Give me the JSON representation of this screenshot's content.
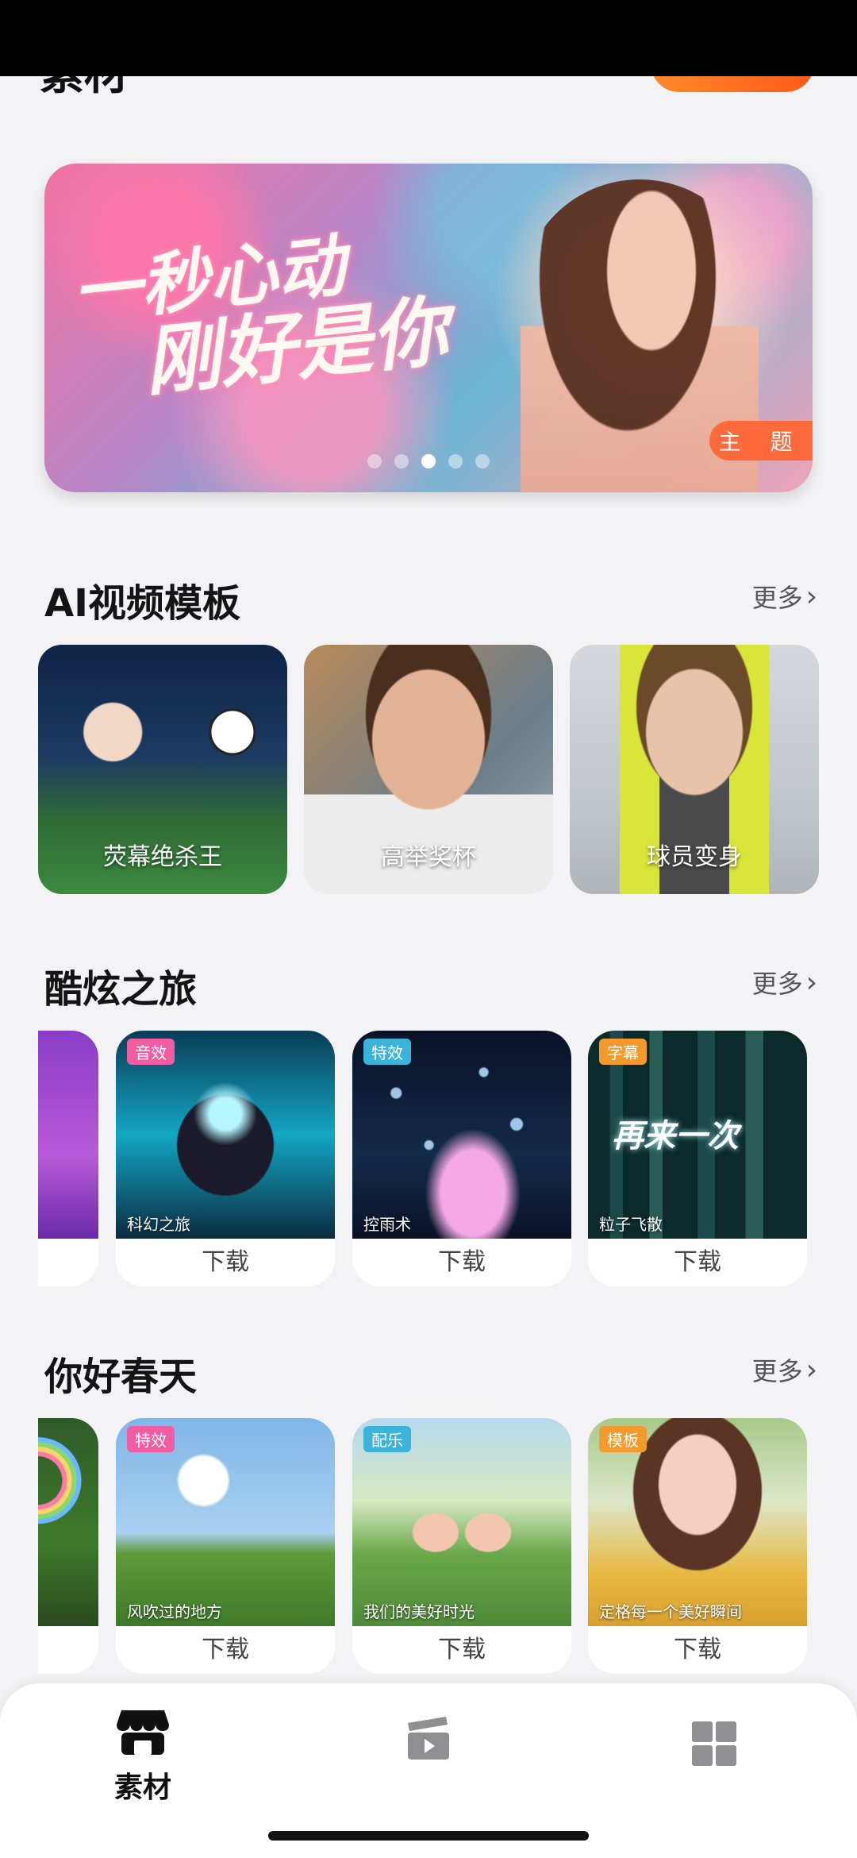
{
  "header": {
    "title": "素材"
  },
  "banner": {
    "line1": "一秒心动",
    "line2": "刚好是你",
    "tag": "主 题",
    "dots_total": 5,
    "dots_active_index": 2
  },
  "sections": {
    "ai": {
      "title": "AI视频模板",
      "more": "更多",
      "cards": [
        {
          "label": "荧幕绝杀王"
        },
        {
          "label": "高举奖杯"
        },
        {
          "label": "球员变身"
        }
      ]
    },
    "cool": {
      "title": "酷炫之旅",
      "more": "更多",
      "cards": [
        {
          "badge": "音效",
          "label": "科幻之旅",
          "action": "下载"
        },
        {
          "badge": "特效",
          "label": "控雨术",
          "action": "下载"
        },
        {
          "badge": "字幕",
          "label": "粒子飞散",
          "action": "下载",
          "overlay": "再来一次"
        }
      ]
    },
    "spring": {
      "title": "你好春天",
      "more": "更多",
      "cards": [
        {
          "badge": "特效",
          "label": "风吹过的地方",
          "action": "下载"
        },
        {
          "badge": "配乐",
          "label": "我们的美好时光",
          "action": "下载"
        },
        {
          "badge": "模板",
          "label": "定格每一个美好瞬间",
          "action": "下载"
        }
      ]
    }
  },
  "nav": {
    "items": [
      {
        "label": "素材",
        "icon": "store-icon",
        "active": true
      },
      {
        "label": "",
        "icon": "video-clapper-icon",
        "active": false
      },
      {
        "label": "",
        "icon": "grid-icon",
        "active": false
      }
    ]
  },
  "colors": {
    "accent": "#ff6a3d",
    "badge_pink": "#f25ca3",
    "badge_blue": "#3cb3d8",
    "badge_orange": "#f49a2c",
    "background": "#f3f3f5"
  }
}
